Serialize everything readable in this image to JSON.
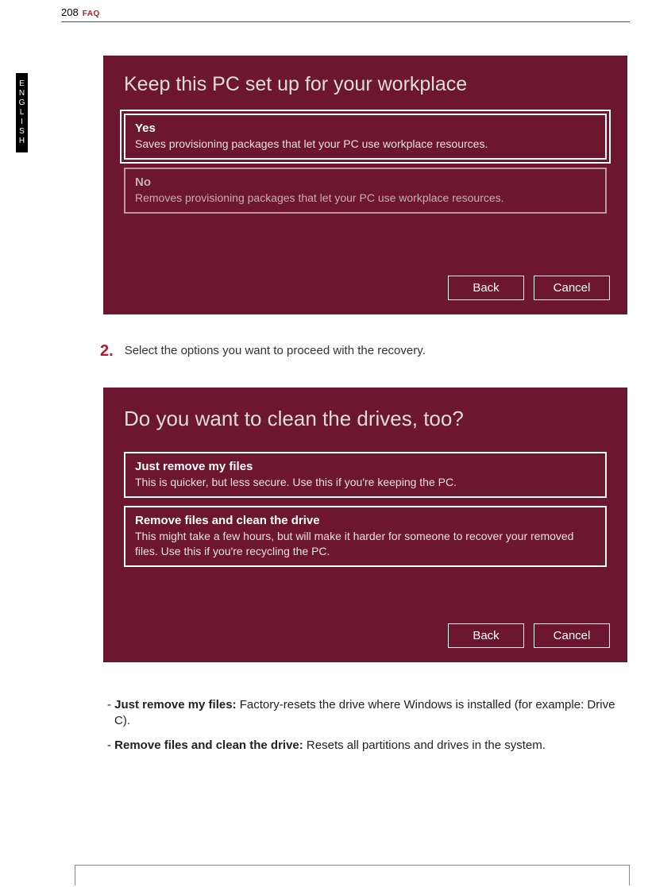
{
  "header": {
    "page_number": "208",
    "section": "FAQ"
  },
  "language_tab": "ENGLISH",
  "screenshot1": {
    "title": "Keep this PC set up for your workplace",
    "option_yes": {
      "title": "Yes",
      "desc": "Saves provisioning packages that let your PC use workplace resources."
    },
    "option_no": {
      "title": "No",
      "desc": "Removes provisioning packages that let your PC use workplace resources."
    },
    "back": "Back",
    "cancel": "Cancel"
  },
  "step": {
    "number": "2.",
    "text": "Select the options you want to proceed with the recovery."
  },
  "screenshot2": {
    "title": "Do you want to clean the drives, too?",
    "option_a": {
      "title": "Just remove my files",
      "desc": "This is quicker, but less secure. Use this if you're keeping the PC."
    },
    "option_b": {
      "title": "Remove files and clean the drive",
      "desc": "This might take a few hours, but will make it harder for someone to recover your removed files. Use this if you're recycling the PC."
    },
    "back": "Back",
    "cancel": "Cancel"
  },
  "bullets": {
    "b1_label": "Just remove my files:",
    "b1_text": " Factory-resets the drive where Windows is installed (for example: Drive C).",
    "b2_label": "Remove files and clean the drive:",
    "b2_text": " Resets all partitions and drives in the system."
  }
}
